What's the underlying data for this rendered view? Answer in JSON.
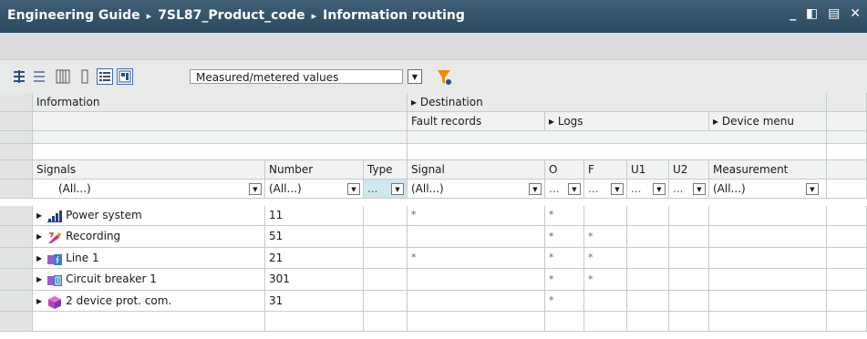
{
  "window": {
    "breadcrumb": [
      "Engineering Guide",
      "7SL87_Product_code",
      "Information routing"
    ],
    "separator": "▸",
    "controls": "_ ◧ ▤ ✕"
  },
  "toolbar": {
    "filter_value": "Measured/metered values"
  },
  "headers": {
    "information": "Information",
    "destination": "▸ Destination",
    "fault_records": "Fault records",
    "logs": "▸ Logs",
    "device_menu": "▸ Device menu",
    "signals": "Signals",
    "number": "Number",
    "type": "Type",
    "signal": "Signal",
    "o": "O",
    "f": "F",
    "u1": "U1",
    "u2": "U2",
    "measurement": "Measurement"
  },
  "filters": {
    "all": "(All...)",
    "dots": "..."
  },
  "rows": [
    {
      "name": "Power system",
      "number": "11",
      "signal": "*",
      "o": "*",
      "f": ""
    },
    {
      "name": "Recording",
      "number": "51",
      "signal": "",
      "o": "*",
      "f": "*"
    },
    {
      "name": "Line 1",
      "number": "21",
      "signal": "*",
      "o": "*",
      "f": "*"
    },
    {
      "name": "Circuit breaker 1",
      "number": "301",
      "signal": "",
      "o": "*",
      "f": "*"
    },
    {
      "name": "2 device prot. com.",
      "number": "31",
      "signal": "",
      "o": "*",
      "f": ""
    }
  ]
}
